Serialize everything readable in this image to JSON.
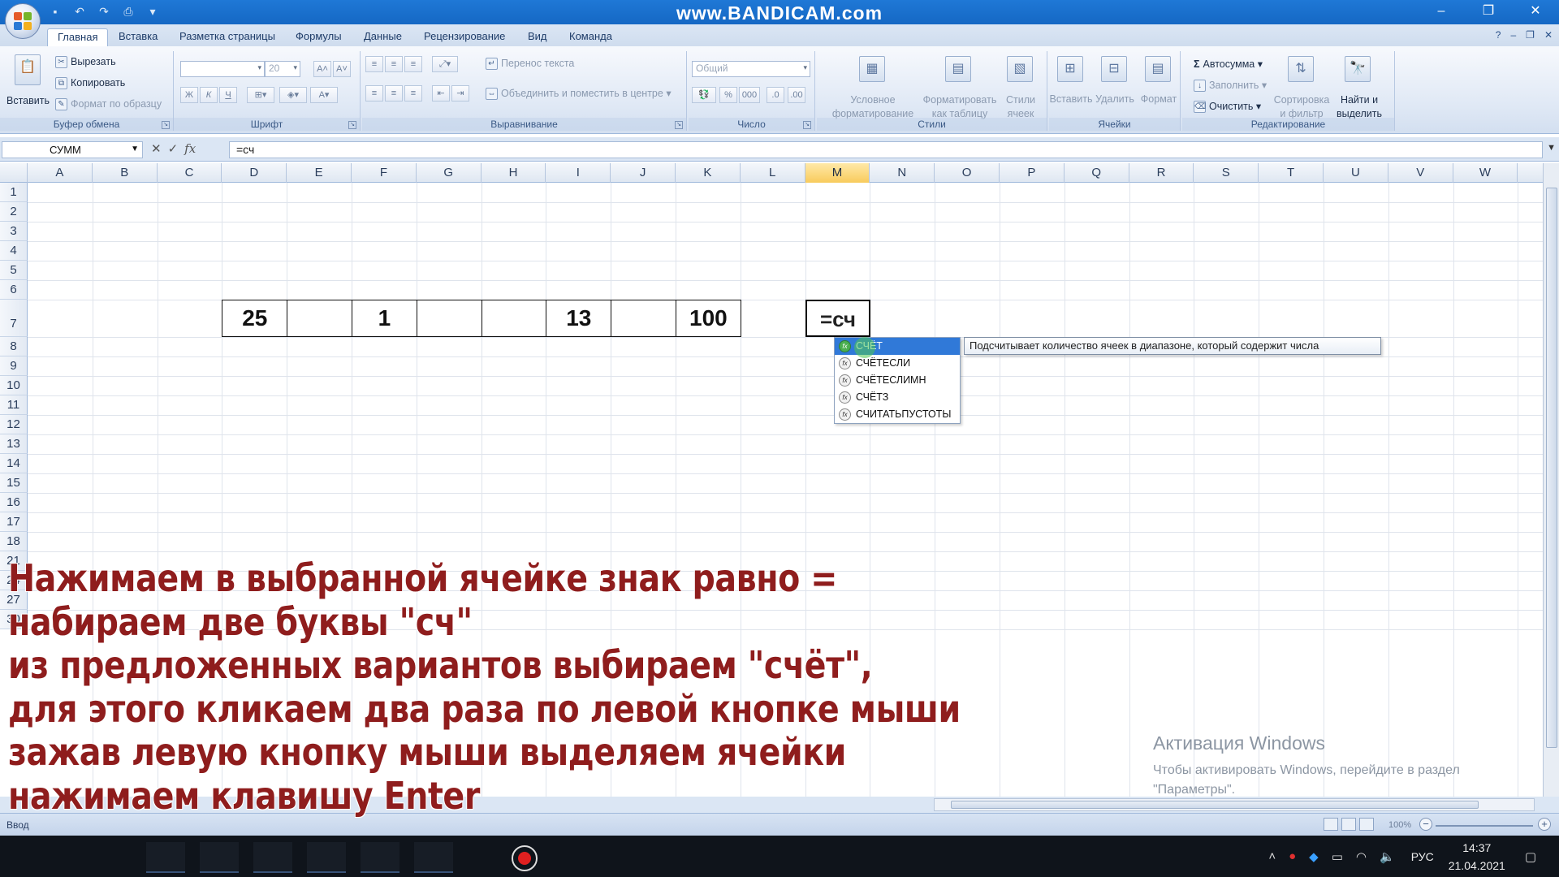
{
  "titlebar": {
    "watermark": "www.BANDICAM.com"
  },
  "tabs": [
    {
      "label": "Главная",
      "active": true
    },
    {
      "label": "Вставка"
    },
    {
      "label": "Разметка страницы"
    },
    {
      "label": "Формулы"
    },
    {
      "label": "Данные"
    },
    {
      "label": "Рецензирование"
    },
    {
      "label": "Вид"
    },
    {
      "label": "Команда"
    }
  ],
  "ribbon": {
    "clipboard": {
      "label": "Буфер обмена",
      "paste": "Вставить",
      "cut": "Вырезать",
      "copy": "Копировать",
      "format_painter": "Формат по образцу"
    },
    "font": {
      "label": "Шрифт",
      "size": "20",
      "bold": "Ж",
      "italic": "К",
      "underline": "Ч"
    },
    "alignment": {
      "label": "Выравнивание",
      "wrap": "Перенос текста",
      "merge": "Объединить и поместить в центре"
    },
    "number": {
      "label": "Число",
      "format": "Общий"
    },
    "styles": {
      "label": "Стили",
      "conditional_1": "Условное",
      "conditional_2": "форматирование",
      "astable_1": "Форматировать",
      "astable_2": "как таблицу",
      "cellstyles_1": "Стили",
      "cellstyles_2": "ячеек"
    },
    "cells": {
      "label": "Ячейки",
      "insert": "Вставить",
      "delete": "Удалить",
      "format": "Формат"
    },
    "editing": {
      "label": "Редактирование",
      "autosum": "Автосумма",
      "fill": "Заполнить",
      "clear": "Очистить",
      "sort_1": "Сортировка",
      "sort_2": "и фильтр",
      "find_1": "Найти и",
      "find_2": "выделить"
    }
  },
  "formula_bar": {
    "name_box": "СУММ",
    "formula": "=сч"
  },
  "columns": [
    "A",
    "B",
    "C",
    "D",
    "E",
    "F",
    "G",
    "H",
    "I",
    "J",
    "K",
    "L",
    "M",
    "N",
    "O",
    "P",
    "Q",
    "R",
    "S",
    "T",
    "U",
    "V",
    "W"
  ],
  "active_column": "M",
  "rows": [
    "1",
    "2",
    "3",
    "4",
    "5",
    "6",
    "7",
    "8",
    "9",
    "10",
    "11",
    "12",
    "13",
    "14",
    "15",
    "16",
    "17",
    "18",
    "21",
    "24",
    "27",
    "30"
  ],
  "cells": {
    "D7": "25",
    "F7": "1",
    "I7": "13",
    "K7": "100",
    "M7": "=сч"
  },
  "autocomplete": {
    "items": [
      "СЧЁТ",
      "СЧЁТЕСЛИ",
      "СЧЁТЕСЛИМН",
      "СЧЁТЗ",
      "СЧИТАТЬПУСТОТЫ"
    ],
    "selected_index": 0,
    "tooltip": "Подсчитывает количество ячеек в диапазоне, который содержит числа"
  },
  "status": {
    "mode": "Ввод",
    "zoom": "100%"
  },
  "activation": {
    "title": "Активация Windows",
    "line1": "Чтобы активировать Windows, перейдите в раздел",
    "line2": "\"Параметры\"."
  },
  "taskbar": {
    "lang": "РУС",
    "time": "14:37",
    "date": "21.04.2021"
  },
  "caption": {
    "lines": [
      "Нажимаем в выбранной ячейке знак равно =",
      "набираем две буквы \"сч\"",
      "из предложенных вариантов выбираем \"счёт\",",
      "для этого кликаем два раза по левой кнопке мыши",
      "зажав левую кнопку мыши выделяем ячейки",
      "нажимаем клавишу Enter"
    ],
    "color": "#8f1d1d"
  }
}
